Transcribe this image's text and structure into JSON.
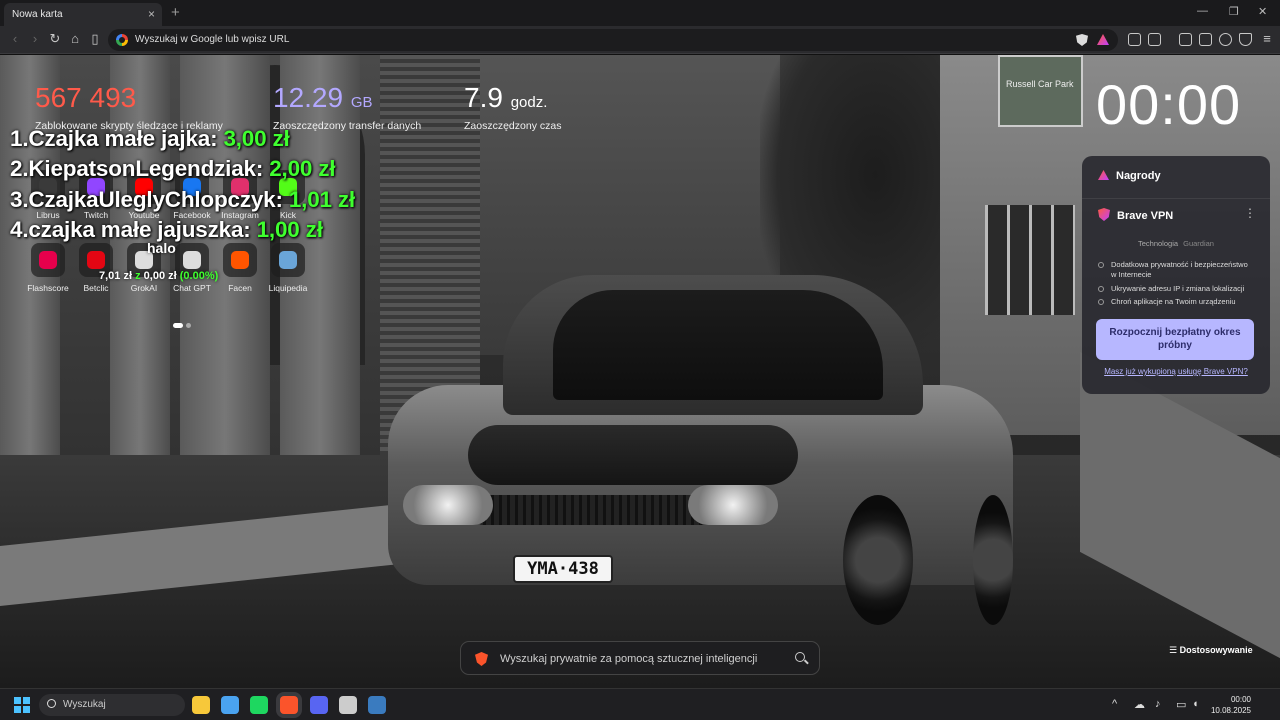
{
  "browser": {
    "tab_title": "Nowa karta",
    "tab_close": "×",
    "new_tab": "+",
    "url_placeholder": "Wyszukaj w Google lub wpisz URL",
    "window_controls": [
      "—",
      "❐",
      "✕"
    ]
  },
  "stats": [
    {
      "value": "567 493",
      "unit": "",
      "label": "Zablokowane skrypty śledzące i reklamy",
      "color": "#ff5a4a"
    },
    {
      "value": "12.29",
      "unit": "GB",
      "label": "Zaoszczędzony transfer danych",
      "color": "#b3a8ff"
    },
    {
      "value": "7.9",
      "unit": "godz.",
      "label": "Zaoszczędzony czas",
      "color": "#ffffff"
    }
  ],
  "clock": "00:00",
  "top_sites": [
    {
      "label": "Librus",
      "icon": "librus-icon",
      "color": "#3a3a3a"
    },
    {
      "label": "Twitch",
      "icon": "twitch-icon",
      "color": "#9146ff"
    },
    {
      "label": "Youtube",
      "icon": "youtube-icon",
      "color": "#ff0000"
    },
    {
      "label": "Facebook",
      "icon": "facebook-icon",
      "color": "#1877f2"
    },
    {
      "label": "Instagram",
      "icon": "instagram-icon",
      "color": "#e1306c"
    },
    {
      "label": "Kick",
      "icon": "kick-icon",
      "color": "#53fc18"
    },
    {
      "label": "Flashscore",
      "icon": "flashscore-icon",
      "color": "#e6004c"
    },
    {
      "label": "Betclic",
      "icon": "betclic-icon",
      "color": "#e30613"
    },
    {
      "label": "GrokAI",
      "icon": "grok-icon",
      "color": "#dddddd"
    },
    {
      "label": "Chat GPT",
      "icon": "chatgpt-icon",
      "color": "#dddddd"
    },
    {
      "label": "Facen",
      "icon": "faceit-icon",
      "color": "#ff5500"
    },
    {
      "label": "Liquipedia",
      "icon": "liquipedia-icon",
      "color": "#6aa5d8"
    }
  ],
  "ranking": [
    {
      "name": "1.Czajka małe jajka: ",
      "amount": "3,00 zł"
    },
    {
      "name": "2.KiepatsonLegendziak: ",
      "amount": "2,00 zł"
    },
    {
      "name": "3.CzajkaUleglyChlopczyk: ",
      "amount": "1,01 zł"
    },
    {
      "name": "4.czajka małe jajuszka: ",
      "amount": "1,00 zł"
    }
  ],
  "donation": {
    "greeting": "halo",
    "current": "7,01 zł",
    "joiner": "z",
    "goal": "0,00 zł",
    "percent": "(0.00%)"
  },
  "vpn_panel": {
    "rewards": "Nagrody",
    "title": "Brave VPN",
    "menu": "⋮",
    "tech": "Technologia",
    "tech_brand": "Guardian",
    "features": [
      "Dodatkowa prywatność i bezpieczeństwo w Internecie",
      "Ukrywanie adresu IP i zmiana lokalizacji",
      "Chroń aplikacje na Twoim urządzeniu"
    ],
    "cta": "Rozpocznij bezpłatny okres próbny",
    "link": "Masz już wykupioną usługę Brave VPN?"
  },
  "search": {
    "placeholder": "Wyszukaj prywatnie za pomocą sztucznej inteligencji"
  },
  "customize": "Dostosowywanie",
  "plate": "YMA·438",
  "street_sign": "Russell Car Park",
  "taskbar": {
    "search": "Wyszukaj",
    "apps": [
      {
        "icon": "file-explorer-icon",
        "color": "#f7c83a"
      },
      {
        "icon": "microsoft-store-icon",
        "color": "#4aa3f0"
      },
      {
        "icon": "spotify-icon",
        "color": "#1ed760"
      },
      {
        "icon": "brave-icon",
        "color": "#fb542b"
      },
      {
        "icon": "discord-icon",
        "color": "#5865f2"
      },
      {
        "icon": "obs-icon",
        "color": "#cccccc"
      },
      {
        "icon": "steam-icon",
        "color": "#3a7bbf"
      }
    ],
    "time": "00:00",
    "date": "10.08.2025"
  }
}
